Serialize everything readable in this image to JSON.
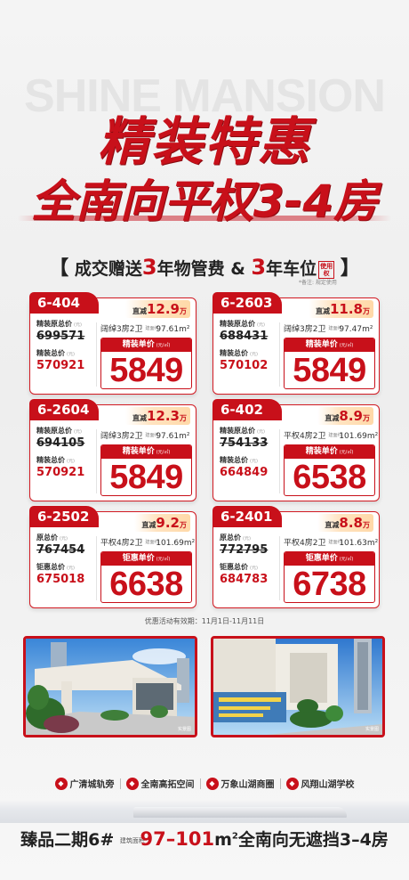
{
  "watermark": "SHINE MANSION",
  "headline": {
    "line1": "精装特惠",
    "line2": "全南向平权3-4房"
  },
  "promo": {
    "prefix": "成交赠送",
    "years1": "3",
    "item1": "年物管费",
    "amp": "&",
    "years2": "3",
    "item2": "年车位",
    "tag": "使用权",
    "note": "*备注: 规定使用"
  },
  "cards": [
    {
      "unit": "6-404",
      "drop_label": "直减",
      "drop": "12.9",
      "drop_unit": "万",
      "orig_label": "精装原总价",
      "orig": "699571",
      "total_label": "精装总价",
      "total": "570921",
      "layout": "阔绰3房2卫",
      "area_label": "建面约",
      "area": "97.61m²",
      "price_label": "精装单价",
      "price": "5849",
      "money_unit": "(元)",
      "price_unit": "(元/㎡)"
    },
    {
      "unit": "6-2603",
      "drop_label": "直减",
      "drop": "11.8",
      "drop_unit": "万",
      "orig_label": "精装原总价",
      "orig": "688431",
      "total_label": "精装总价",
      "total": "570102",
      "layout": "阔绰3房2卫",
      "area_label": "建面约",
      "area": "97.47m²",
      "price_label": "精装单价",
      "price": "5849",
      "money_unit": "(元)",
      "price_unit": "(元/㎡)"
    },
    {
      "unit": "6-2604",
      "drop_label": "直减",
      "drop": "12.3",
      "drop_unit": "万",
      "orig_label": "精装原总价",
      "orig": "694105",
      "total_label": "精装总价",
      "total": "570921",
      "layout": "阔绰3房2卫",
      "area_label": "建面约",
      "area": "97.61m²",
      "price_label": "精装单价",
      "price": "5849",
      "money_unit": "(元)",
      "price_unit": "(元/㎡)"
    },
    {
      "unit": "6-402",
      "drop_label": "直减",
      "drop": "8.9",
      "drop_unit": "万",
      "orig_label": "精装原总价",
      "orig": "754133",
      "total_label": "精装总价",
      "total": "664849",
      "layout": "平权4房2卫",
      "area_label": "建面约",
      "area": "101.69m²",
      "price_label": "精装单价",
      "price": "6538",
      "money_unit": "(元)",
      "price_unit": "(元/㎡)"
    },
    {
      "unit": "6-2502",
      "drop_label": "直减",
      "drop": "9.2",
      "drop_unit": "万",
      "orig_label": "原总价",
      "orig": "767454",
      "total_label": "钜惠总价",
      "total": "675018",
      "layout": "平权4房2卫",
      "area_label": "建面约",
      "area": "101.69m²",
      "price_label": "钜惠单价",
      "price": "6638",
      "money_unit": "(元)",
      "price_unit": "(元/㎡)"
    },
    {
      "unit": "6-2401",
      "drop_label": "直减",
      "drop": "8.8",
      "drop_unit": "万",
      "orig_label": "原总价",
      "orig": "772795",
      "total_label": "钜惠总价",
      "total": "684783",
      "layout": "平权4房2卫",
      "area_label": "建面约",
      "area": "101.63m²",
      "price_label": "钜惠单价",
      "price": "6738",
      "money_unit": "(元)",
      "price_unit": "(元/㎡)"
    }
  ],
  "validity": "优惠活动有效期：11月1日-11月11日",
  "photos": [
    {
      "caption": "实景图"
    },
    {
      "caption": "实景图"
    }
  ],
  "features": [
    {
      "icon": "rail-icon",
      "label": "广清城轨旁"
    },
    {
      "icon": "space-icon",
      "label": "全南高拓空间"
    },
    {
      "icon": "mall-icon",
      "label": "万象山湖商圈"
    },
    {
      "icon": "school-icon",
      "label": "风翔山湖学校"
    }
  ],
  "footer": {
    "prefix": "臻品二期6#",
    "area_label": "建筑面积",
    "range": "97–101",
    "unit": "m",
    "sup": "2",
    "suffix": "全南向无遮挡3–4房"
  },
  "colors": {
    "brand_red": "#c8101a",
    "drop_badge": "#ffe3c0",
    "background": "#f1f1f1"
  }
}
